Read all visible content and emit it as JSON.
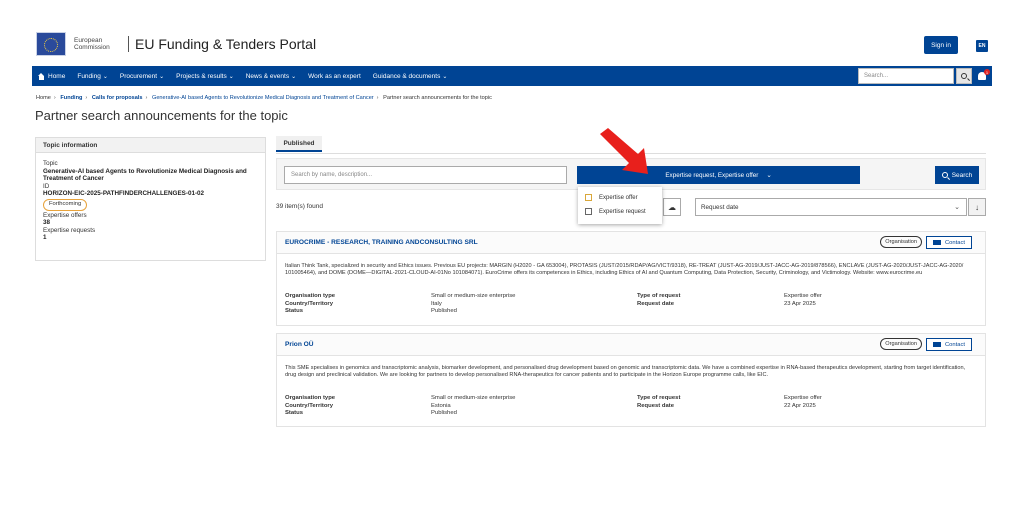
{
  "header": {
    "org_line1": "European",
    "org_line2": "Commission",
    "portal_title": "EU Funding & Tenders Portal",
    "signin_label": "Sign in",
    "lang_code": "EN"
  },
  "nav": {
    "items": [
      {
        "label": "Home",
        "chevron": false
      },
      {
        "label": "Funding",
        "chevron": true
      },
      {
        "label": "Procurement",
        "chevron": true
      },
      {
        "label": "Projects & results",
        "chevron": true
      },
      {
        "label": "News & events",
        "chevron": true
      },
      {
        "label": "Work as an expert",
        "chevron": false
      },
      {
        "label": "Guidance & documents",
        "chevron": true
      }
    ],
    "search_placeholder": "Search...",
    "notification_count": "1"
  },
  "breadcrumb": [
    {
      "label": "Home",
      "style": "plain"
    },
    {
      "label": "Funding",
      "style": "bold"
    },
    {
      "label": "Calls for proposals",
      "style": "bold"
    },
    {
      "label": "Generative-AI based Agents to Revolutionize Medical Diagnosis and Treatment of Cancer",
      "style": "link"
    },
    {
      "label": "Partner search announcements for the topic",
      "style": "plain"
    }
  ],
  "page_title": "Partner search announcements for the topic",
  "topic_panel": {
    "heading": "Topic information",
    "topic_label": "Topic",
    "topic_value": "Generative-AI based Agents to Revolutionize Medical Diagnosis and Treatment of Cancer",
    "id_label": "ID",
    "id_value": "HORIZON-EIC-2025-PATHFINDERCHALLENGES-01-02",
    "status_badge": "Forthcoming",
    "offers_label": "Expertise offers",
    "offers_value": "38",
    "requests_label": "Expertise requests",
    "requests_value": "1"
  },
  "tabs": {
    "published": "Published"
  },
  "filters": {
    "search_placeholder": "Search by name, description...",
    "type_selected": "Expertise request, Expertise offer",
    "search_button": "Search",
    "options": [
      "Expertise offer",
      "Expertise request"
    ]
  },
  "results": {
    "count_text": "39 item(s) found",
    "sort_selected": "Request date"
  },
  "cards": [
    {
      "title": "EUROCRIME - RESEARCH, TRAINING ANDCONSULTING SRL",
      "badge": "Organisation",
      "contact": "Contact",
      "description": "Italian Think Tank, specialized in security and Ethics issues. Previous EU projects: MARGIN (H2020 - GA 653004), PROTASIS (JUST/2015/RDAP/AG/VICT/9318), RE-TREAT (JUST-AG-2019/JUST-JACC-AG-2019/878566), ENCLAVE (JUST-AG-2020/JUST-JACC-AG-2020/ 101005464), and DOME (DOME—DIGITAL-2021-CLOUD-AI-01No 101084071). EuroCrime offers its competences in Ethics, including Ethics of AI and Quantum Computing, Data Protection, Security, Criminology, and Victimology. Website: www.eurocrime.eu",
      "org_type_label": "Organisation type",
      "org_type": "Small or medium-size enterprise",
      "country_label": "Country/Territory",
      "country": "Italy",
      "status_label": "Status",
      "status": "Published",
      "request_type_label": "Type of request",
      "request_type": "Expertise offer",
      "request_date_label": "Request date",
      "request_date": "23 Apr 2025"
    },
    {
      "title": "Prion OÜ",
      "badge": "Organisation",
      "contact": "Contact",
      "description": "This SME specialises in genomics and transcriptomic analysis, biomarker development, and personalised drug development based on genomic and transcriptomic data. We have a combined expertise in RNA-based therapeutics development, starting from target identification, drug design and preclinical validation. We are looking for partners to develop personalised RNA-therapeutics for cancer patients and to participate in the Horizon Europe programme calls, like EIC.",
      "org_type_label": "Organisation type",
      "org_type": "Small or medium-size enterprise",
      "country_label": "Country/Territory",
      "country": "Estonia",
      "status_label": "Status",
      "status": "Published",
      "request_type_label": "Type of request",
      "request_type": "Expertise offer",
      "request_date_label": "Request date",
      "request_date": "22 Apr 2025"
    }
  ],
  "colors": {
    "primary": "#004494",
    "annotation_arrow": "#e8201c",
    "badge_border": "#e8a33c"
  }
}
